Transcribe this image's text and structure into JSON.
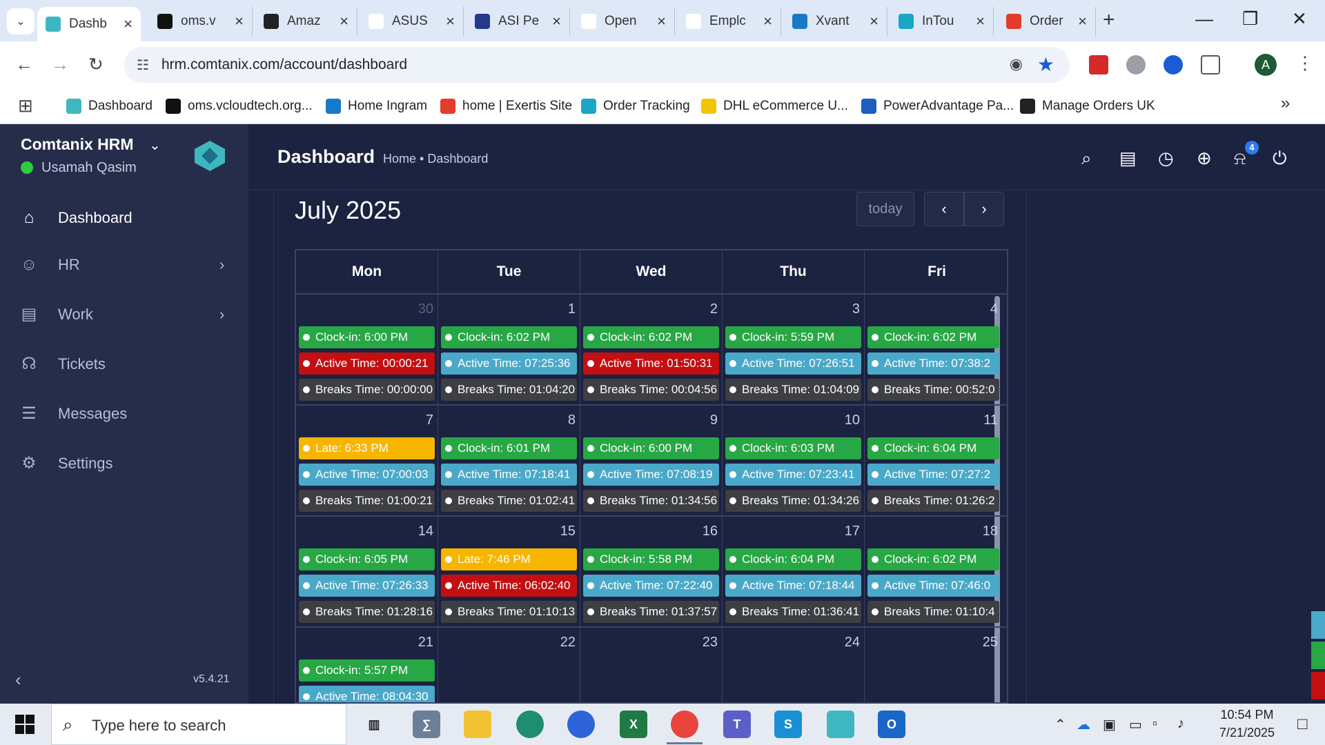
{
  "browser": {
    "tabs": [
      {
        "title": "Dashb",
        "active": true,
        "favicon_color": "#3fb7c0"
      },
      {
        "title": "oms.v",
        "favicon_color": "#111"
      },
      {
        "title": "Amaz",
        "favicon_color": "#222"
      },
      {
        "title": "ASUS",
        "favicon_color": "#fff"
      },
      {
        "title": "ASI Pe",
        "favicon_color": "#213a8c"
      },
      {
        "title": "Open",
        "favicon_color": "#fff"
      },
      {
        "title": "Emplc",
        "favicon_color": "#fff"
      },
      {
        "title": "Xvant",
        "favicon_color": "#1979c9"
      },
      {
        "title": "InTou",
        "favicon_color": "#1aa6c7"
      },
      {
        "title": "Order",
        "favicon_color": "#e23c2a"
      }
    ],
    "url": "hrm.comtanix.com/account/dashboard",
    "profile_initial": "A",
    "bookmarks": [
      {
        "label": "Dashboard",
        "color": "#3fb7c0"
      },
      {
        "label": "oms.vcloudtech.org...",
        "color": "#111"
      },
      {
        "label": "Home Ingram",
        "color": "#1979c9"
      },
      {
        "label": "home | Exertis Site",
        "color": "#e23c2a"
      },
      {
        "label": "Order Tracking",
        "color": "#1aa6c7"
      },
      {
        "label": "DHL eCommerce U...",
        "color": "#f5c400"
      },
      {
        "label": "PowerAdvantage Pa...",
        "color": "#1b5fbf"
      },
      {
        "label": "Manage Orders UK",
        "color": "#222"
      }
    ]
  },
  "sidebar": {
    "brand": "Comtanix HRM",
    "user": "Usamah Qasim",
    "items": [
      {
        "label": "Dashboard",
        "icon": "home-icon",
        "active": true
      },
      {
        "label": "HR",
        "icon": "people-icon",
        "has_children": true
      },
      {
        "label": "Work",
        "icon": "briefcase-icon",
        "has_children": true
      },
      {
        "label": "Tickets",
        "icon": "headset-icon"
      },
      {
        "label": "Messages",
        "icon": "chat-icon"
      },
      {
        "label": "Settings",
        "icon": "gear-icon"
      }
    ],
    "version": "v5.4.21"
  },
  "header": {
    "title": "Dashboard",
    "breadcrumb": "Home • Dashboard",
    "notification_count": "4"
  },
  "calendar": {
    "month_title": "July 2025",
    "today_label": "today",
    "days": [
      "Mon",
      "Tue",
      "Wed",
      "Thu",
      "Fri"
    ],
    "weeks": [
      [
        {
          "num": "30",
          "dim": true,
          "events": [
            [
              "green",
              "Clock-in: 6:00 PM"
            ],
            [
              "red",
              "Active Time: 00:00:21"
            ],
            [
              "gray",
              "Breaks Time: 00:00:00"
            ]
          ]
        },
        {
          "num": "1",
          "events": [
            [
              "green",
              "Clock-in: 6:02 PM"
            ],
            [
              "teal",
              "Active Time: 07:25:36"
            ],
            [
              "gray",
              "Breaks Time: 01:04:20"
            ]
          ]
        },
        {
          "num": "2",
          "events": [
            [
              "green",
              "Clock-in: 6:02 PM"
            ],
            [
              "red",
              "Active Time: 01:50:31"
            ],
            [
              "gray",
              "Breaks Time: 00:04:56"
            ]
          ]
        },
        {
          "num": "3",
          "events": [
            [
              "green",
              "Clock-in: 5:59 PM"
            ],
            [
              "teal",
              "Active Time: 07:26:51"
            ],
            [
              "gray",
              "Breaks Time: 01:04:09"
            ]
          ]
        },
        {
          "num": "4",
          "events": [
            [
              "green",
              "Clock-in: 6:02 PM"
            ],
            [
              "teal",
              "Active Time: 07:38:2"
            ],
            [
              "gray",
              "Breaks Time: 00:52:0"
            ]
          ]
        }
      ],
      [
        {
          "num": "7",
          "events": [
            [
              "yellow",
              "Late: 6:33 PM"
            ],
            [
              "teal",
              "Active Time: 07:00:03"
            ],
            [
              "gray",
              "Breaks Time: 01:00:21"
            ]
          ]
        },
        {
          "num": "8",
          "events": [
            [
              "green",
              "Clock-in: 6:01 PM"
            ],
            [
              "teal",
              "Active Time: 07:18:41"
            ],
            [
              "gray",
              "Breaks Time: 01:02:41"
            ]
          ]
        },
        {
          "num": "9",
          "events": [
            [
              "green",
              "Clock-in: 6:00 PM"
            ],
            [
              "teal",
              "Active Time: 07:08:19"
            ],
            [
              "gray",
              "Breaks Time: 01:34:56"
            ]
          ]
        },
        {
          "num": "10",
          "events": [
            [
              "green",
              "Clock-in: 6:03 PM"
            ],
            [
              "teal",
              "Active Time: 07:23:41"
            ],
            [
              "gray",
              "Breaks Time: 01:34:26"
            ]
          ]
        },
        {
          "num": "11",
          "events": [
            [
              "green",
              "Clock-in: 6:04 PM"
            ],
            [
              "teal",
              "Active Time: 07:27:2"
            ],
            [
              "gray",
              "Breaks Time: 01:26:2"
            ]
          ]
        }
      ],
      [
        {
          "num": "14",
          "events": [
            [
              "green",
              "Clock-in: 6:05 PM"
            ],
            [
              "teal",
              "Active Time: 07:26:33"
            ],
            [
              "gray",
              "Breaks Time: 01:28:16"
            ]
          ]
        },
        {
          "num": "15",
          "events": [
            [
              "yellow",
              "Late: 7:46 PM"
            ],
            [
              "red",
              "Active Time: 06:02:40"
            ],
            [
              "gray",
              "Breaks Time: 01:10:13"
            ]
          ]
        },
        {
          "num": "16",
          "events": [
            [
              "green",
              "Clock-in: 5:58 PM"
            ],
            [
              "teal",
              "Active Time: 07:22:40"
            ],
            [
              "gray",
              "Breaks Time: 01:37:57"
            ]
          ]
        },
        {
          "num": "17",
          "events": [
            [
              "green",
              "Clock-in: 6:04 PM"
            ],
            [
              "teal",
              "Active Time: 07:18:44"
            ],
            [
              "gray",
              "Breaks Time: 01:36:41"
            ]
          ]
        },
        {
          "num": "18",
          "events": [
            [
              "green",
              "Clock-in: 6:02 PM"
            ],
            [
              "teal",
              "Active Time: 07:46:0"
            ],
            [
              "gray",
              "Breaks Time: 01:10:4"
            ]
          ]
        }
      ],
      [
        {
          "num": "21",
          "events": [
            [
              "green",
              "Clock-in: 5:57 PM"
            ],
            [
              "teal",
              "Active Time: 08:04:30"
            ]
          ]
        },
        {
          "num": "22",
          "events": []
        },
        {
          "num": "23",
          "events": []
        },
        {
          "num": "24",
          "events": []
        },
        {
          "num": "25",
          "events": []
        }
      ]
    ]
  },
  "taskbar": {
    "search_placeholder": "Type here to search",
    "time": "10:54 PM",
    "date": "7/21/2025"
  }
}
